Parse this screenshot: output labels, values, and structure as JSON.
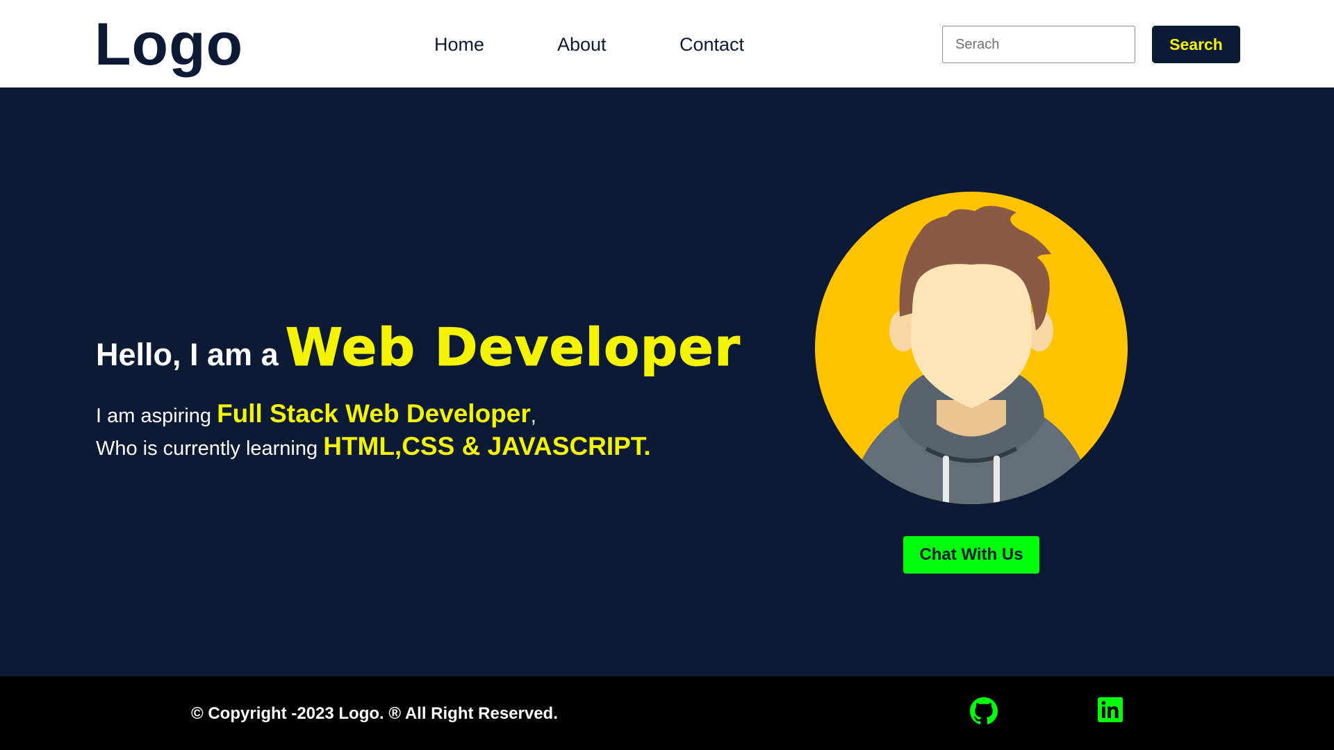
{
  "header": {
    "logo": "Logo",
    "nav": [
      {
        "label": "Home"
      },
      {
        "label": "About"
      },
      {
        "label": "Contact"
      }
    ],
    "search": {
      "placeholder": "Serach",
      "value": "",
      "button_label": "Search"
    }
  },
  "hero": {
    "greeting": "Hello, I am a",
    "role": "Web Developer",
    "bio_line1_prefix": "I am aspiring ",
    "bio_line1_highlight": "Full Stack Web Developer",
    "bio_line1_suffix": ",",
    "bio_line2_prefix": "Who is currently learning ",
    "bio_line2_highlight": "HTML,CSS & JAVASCRIPT.",
    "chat_button_label": "Chat With Us",
    "avatar_icon": "user-avatar-icon"
  },
  "footer": {
    "copyright": "© Copyright -2023 Logo.   ® All Right Reserved.",
    "social_icons": [
      "github-icon",
      "linkedin-icon"
    ]
  },
  "colors": {
    "navy": "#0d1a36",
    "accent_yellow": "#f4f400",
    "accent_green": "#00ff0a",
    "avatar_bg": "#ffc300",
    "footer_bg": "#000000"
  }
}
